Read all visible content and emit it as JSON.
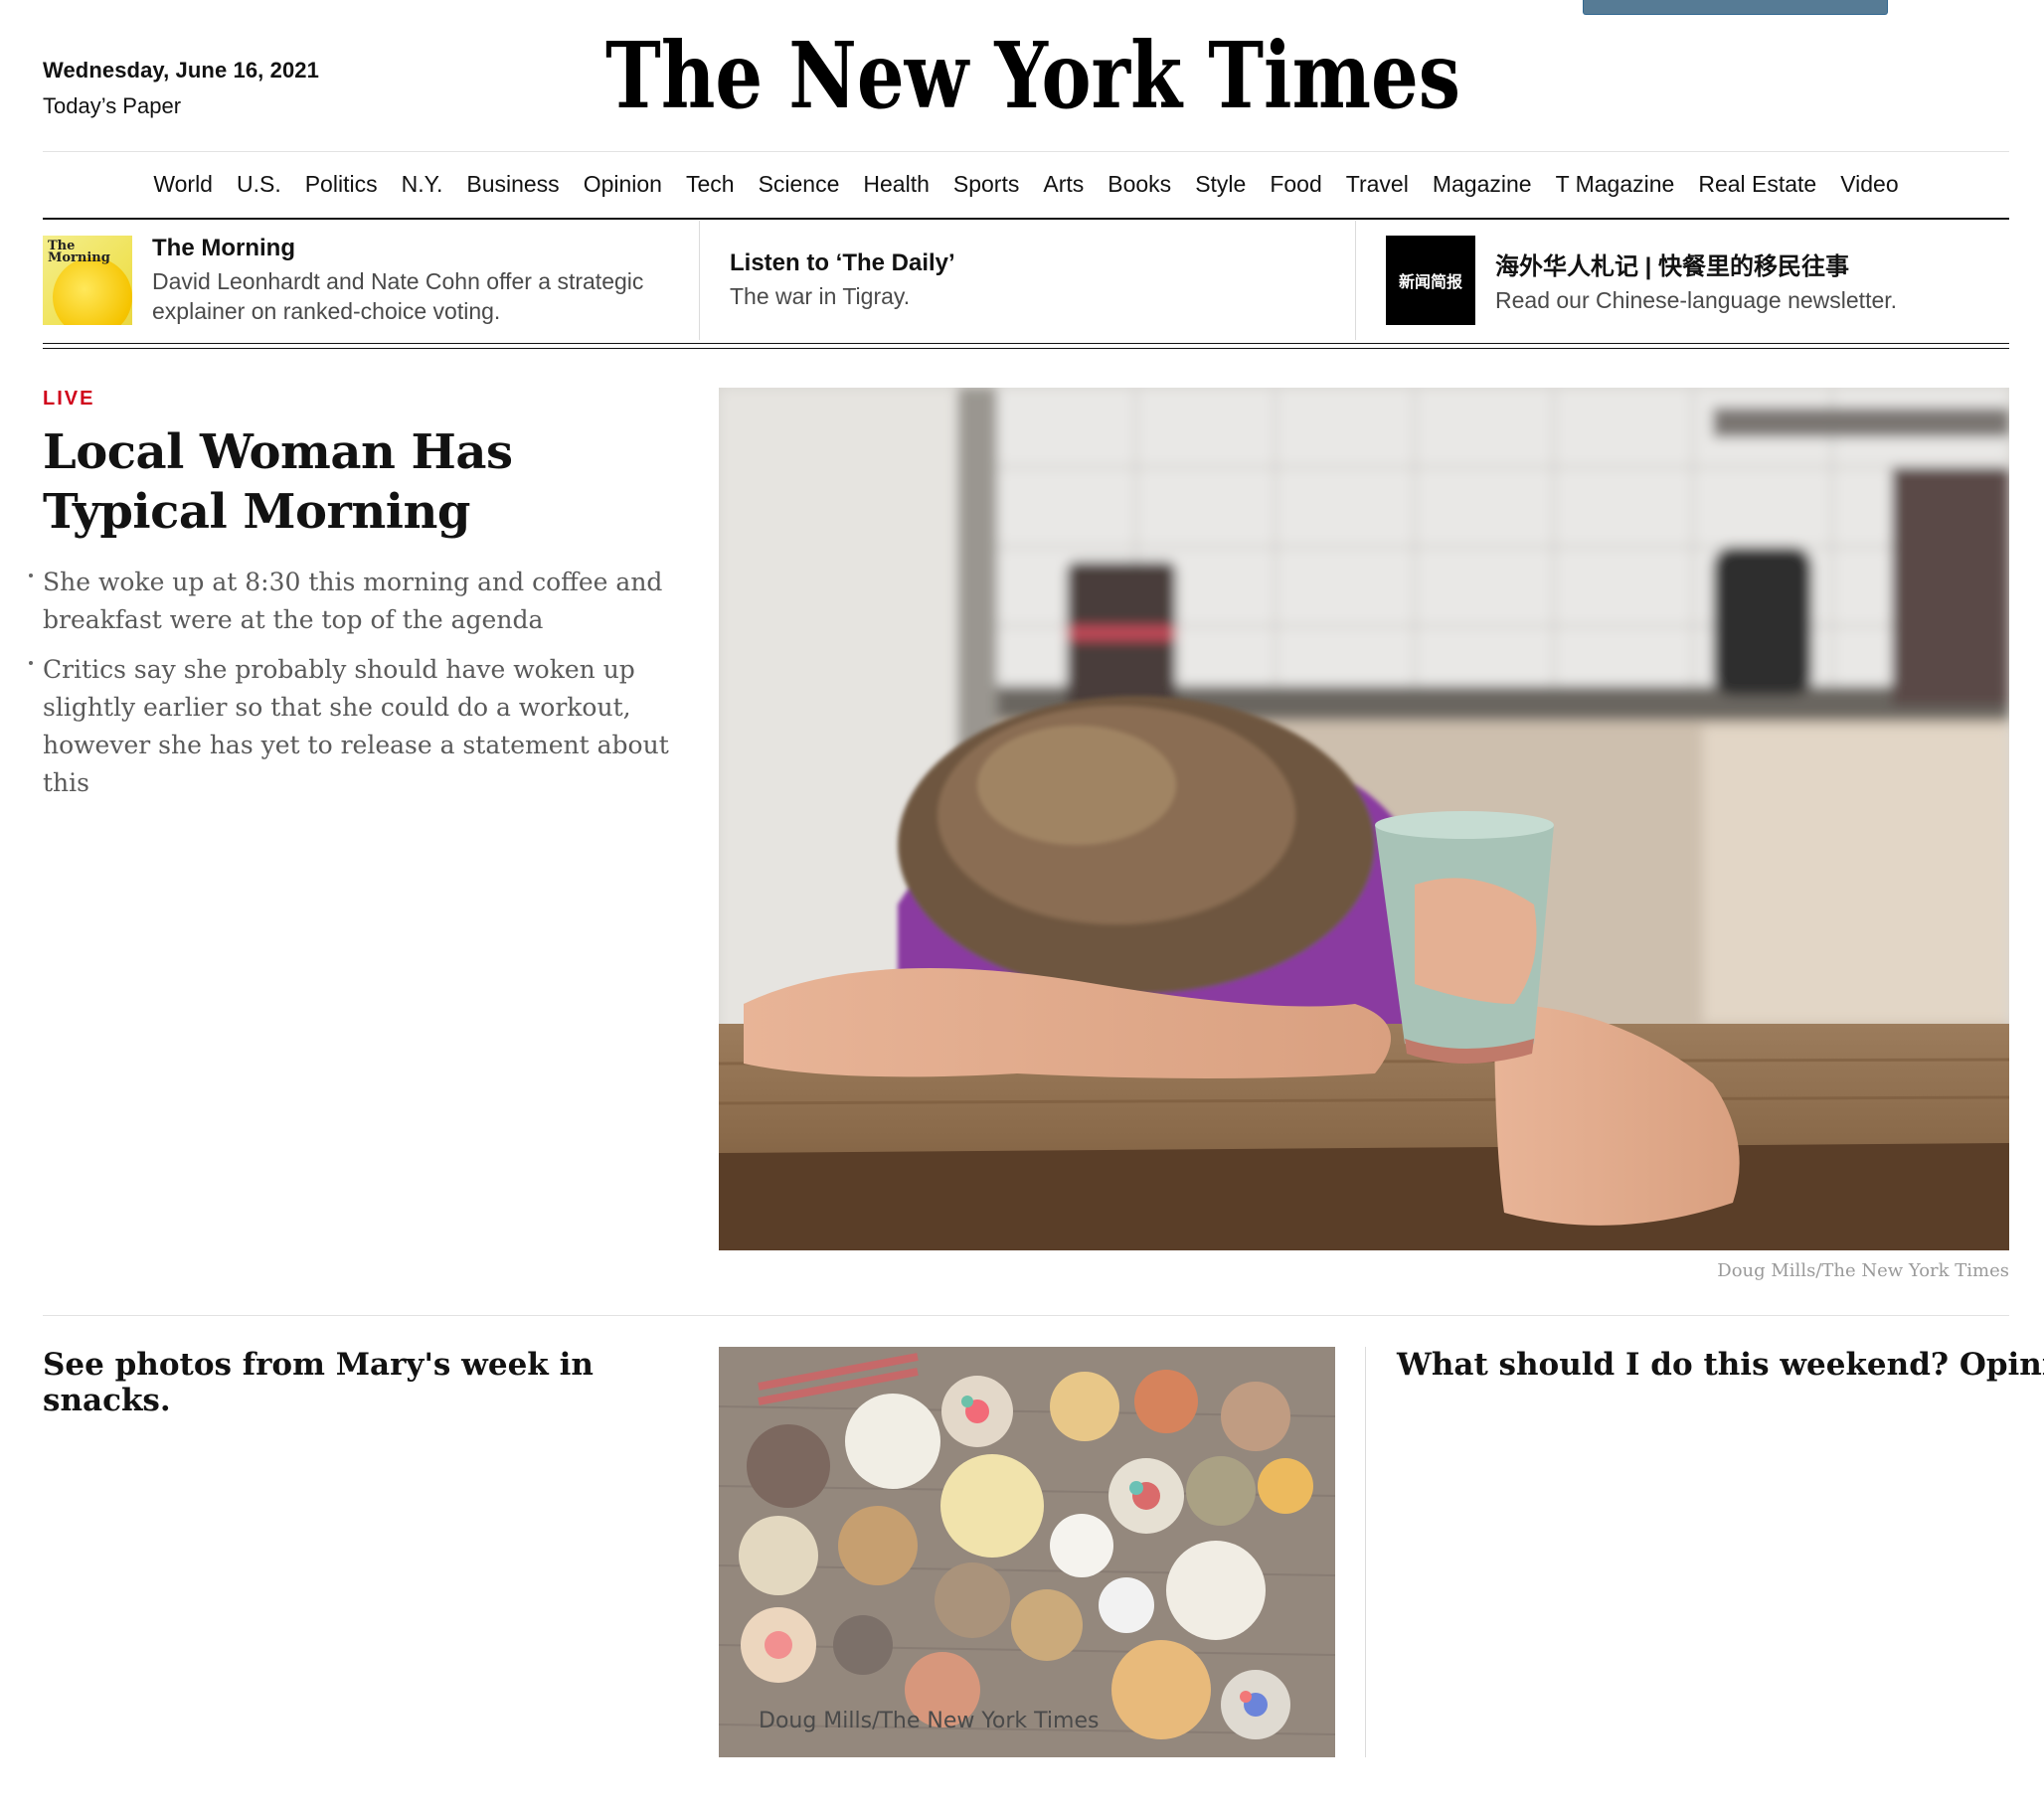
{
  "header": {
    "date": "Wednesday, June 16, 2021",
    "todays_paper": "Today’s Paper",
    "logo": "The New York Times"
  },
  "nav": {
    "items": [
      "World",
      "U.S.",
      "Politics",
      "N.Y.",
      "Business",
      "Opinion",
      "Tech",
      "Science",
      "Health",
      "Sports",
      "Arts",
      "Books",
      "Style",
      "Food",
      "Travel",
      "Magazine",
      "T Magazine",
      "Real Estate",
      "Video"
    ]
  },
  "briefings": [
    {
      "thumb_text": "The Morning",
      "title": "The Morning",
      "subtitle": "David Leonhardt and Nate Cohn offer a strategic explainer on ranked-choice voting."
    },
    {
      "title": "Listen to ‘The Daily’",
      "subtitle": "The war in Tigray."
    },
    {
      "thumb_text": "新闻简报",
      "title": "海外华人札记 | 快餐里的移民往事",
      "subtitle": "Read our Chinese-language newsletter."
    }
  ],
  "lead": {
    "label": "LIVE",
    "headline": "Local Woman Has Typical Morning",
    "bullets": [
      "She woke up at 8:30 this morning and coffee and breakfast were at the top of the agenda",
      "Critics say she probably should have woken up slightly earlier so that she could do a workout, however she has yet to release a statement about this"
    ],
    "image_credit": "Doug Mills/The New York Times"
  },
  "secondary": {
    "left_headline": "See photos from Mary's week in snacks.",
    "image_credit": "Doug Mills/The New York Times",
    "right_headline": "What should I do this weekend? Opinion"
  },
  "colors": {
    "live_red": "#d0021b",
    "text": "#121212",
    "rule": "#e2e2e2",
    "top_button": "#567b95"
  }
}
